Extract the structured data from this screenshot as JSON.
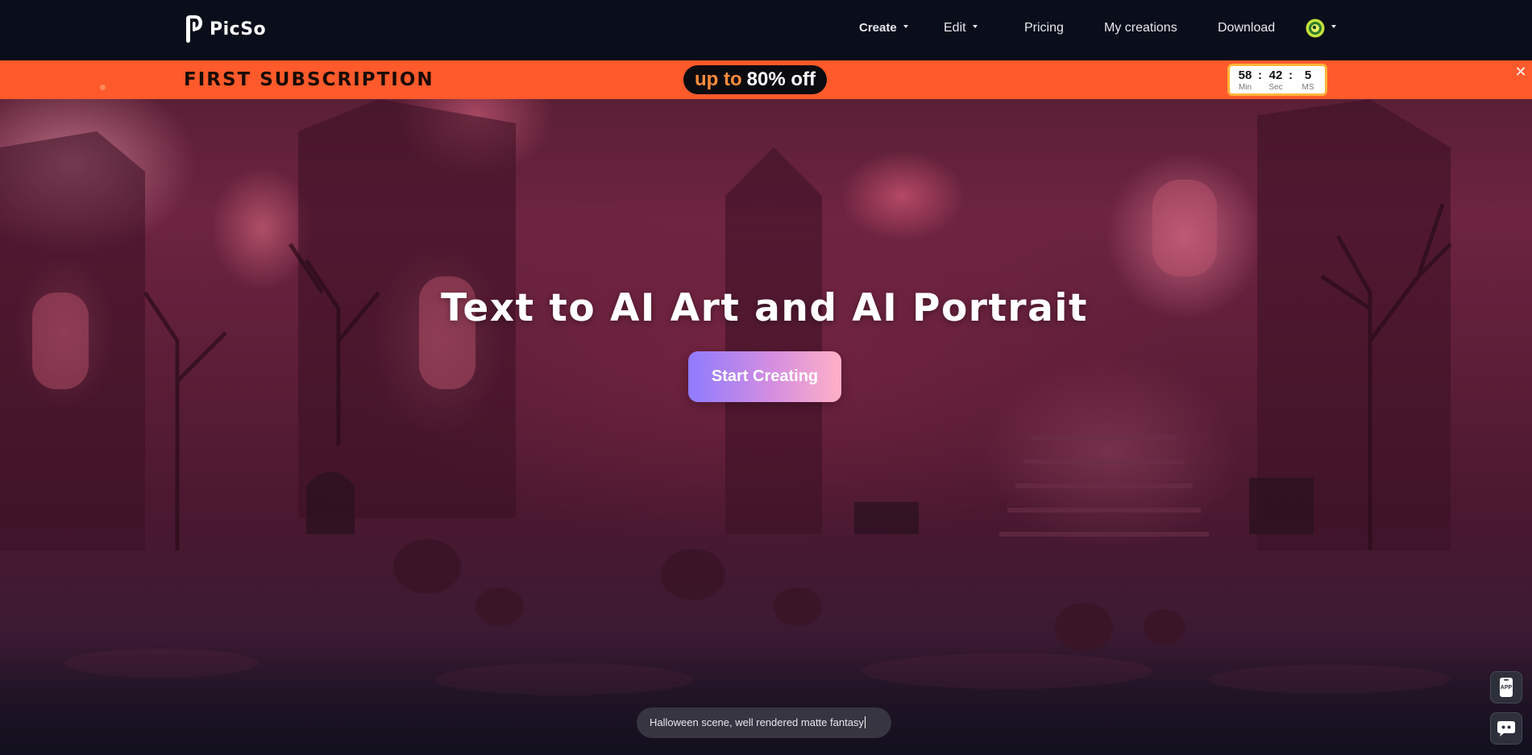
{
  "header": {
    "logo_text": "PicSo",
    "nav": {
      "create": "Create",
      "edit": "Edit",
      "pricing": "Pricing",
      "my_creations": "My creations",
      "download": "Download"
    }
  },
  "promo": {
    "title": "FIRST SUBSCRIPTION",
    "pill_prefix": "up to",
    "pill_suffix": "80% off",
    "countdown": {
      "minutes": "58",
      "seconds": "42",
      "ms": "5",
      "sep": ":",
      "min_label": "Min",
      "sec_label": "Sec",
      "ms_label": "MS"
    },
    "close": "✕"
  },
  "hero": {
    "title": "Text to AI Art and AI Portrait",
    "cta": "Start Creating",
    "prompt_text": "Halloween scene, well rendered matte fantasy"
  },
  "floating": {
    "app_label": "APP"
  },
  "colors": {
    "header_bg": "#0a0e1a",
    "promo_bg": "#ff5a2b",
    "pill_accent": "#ff8c3a",
    "countdown_border": "#ffb43a",
    "cta_gradient_start": "#8f7bff",
    "cta_gradient_end": "#ffb0c6"
  },
  "icons": {
    "logo": "picso-logo-icon",
    "avatar": "user-avatar-icon",
    "app": "phone-app-icon",
    "chat": "chat-bot-icon",
    "close": "close-icon"
  }
}
